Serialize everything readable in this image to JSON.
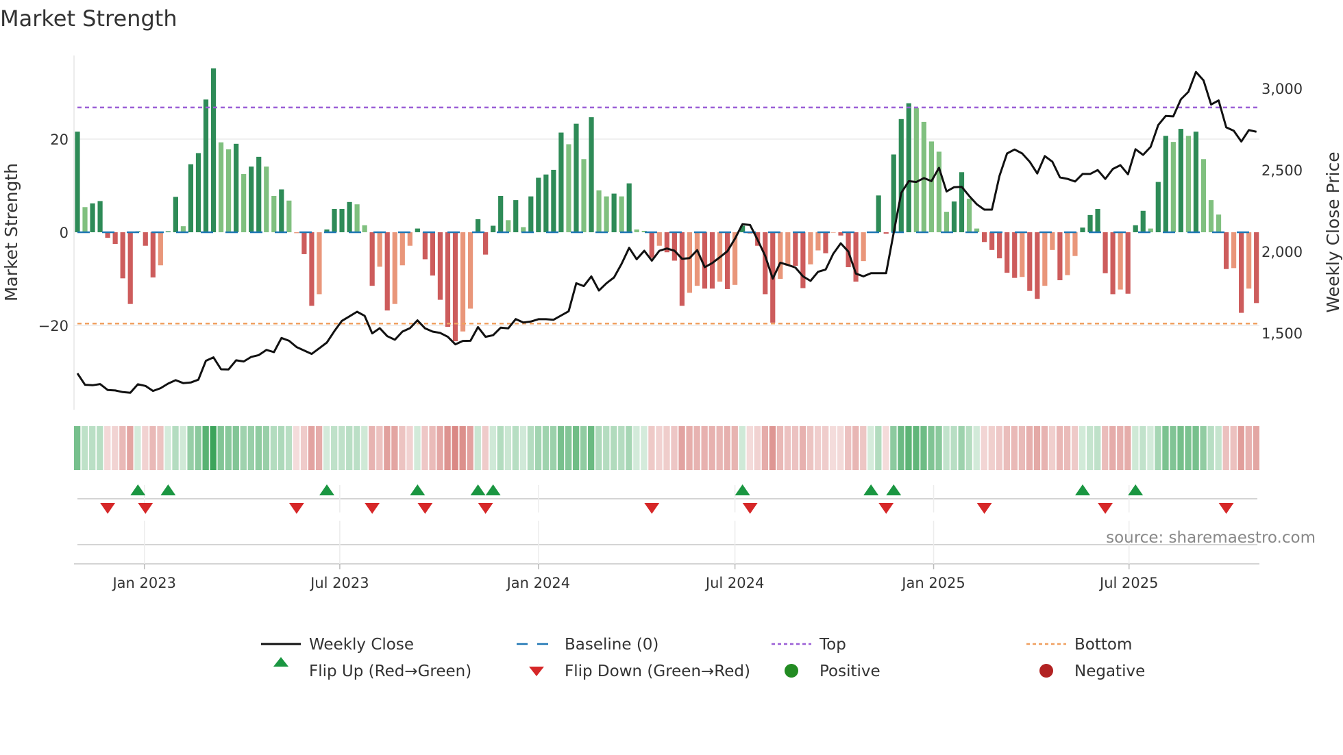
{
  "title": "Market Strength",
  "source": "source: sharemaestro.com",
  "chart_data": {
    "type": "bar",
    "title": "Market Strength",
    "ylabel": "Market Strength",
    "y2label": "Weekly Close Price",
    "ylim": [
      -38.1,
      38.1
    ],
    "y2lim": [
      1029,
      3206
    ],
    "grid": true,
    "legend_placement": "bottom",
    "yticks": [
      {
        "v": 20,
        "label": "20"
      },
      {
        "v": 0,
        "label": "0"
      },
      {
        "v": -20,
        "label": "−20"
      }
    ],
    "y2ticks": [
      {
        "v": 3000,
        "label": "3,000"
      },
      {
        "v": 2500,
        "label": "2,500"
      },
      {
        "v": 2000,
        "label": "2,000"
      },
      {
        "v": 1500,
        "label": "1,500"
      }
    ],
    "xticks": [
      {
        "date": "2023-01-01",
        "label": "Jan 2023"
      },
      {
        "date": "2023-07-01",
        "label": "Jul 2023"
      },
      {
        "date": "2024-01-01",
        "label": "Jan 2024"
      },
      {
        "date": "2024-07-01",
        "label": "Jul 2024"
      },
      {
        "date": "2025-01-01",
        "label": "Jan 2025"
      },
      {
        "date": "2025-07-01",
        "label": "Jul 2025"
      }
    ],
    "start_date": "2022-10-31",
    "frequency": "weekly",
    "top": 26.8,
    "bottom": -19.6,
    "baseline": 0,
    "strength": [
      21.6,
      5.4,
      6.2,
      6.7,
      -1.2,
      -2.5,
      -9.9,
      -15.4,
      0.2,
      -2.9,
      -9.7,
      -7.1,
      0.2,
      7.6,
      1.3,
      14.6,
      17.0,
      28.5,
      35.2,
      19.3,
      17.8,
      19.0,
      12.5,
      14.1,
      16.2,
      14.1,
      7.8,
      9.2,
      6.8,
      -0.2,
      -4.7,
      -15.8,
      -13.3,
      0.6,
      5.0,
      5.0,
      6.5,
      6.0,
      1.5,
      -11.5,
      -7.4,
      -16.8,
      -15.4,
      -7.1,
      -2.9,
      0.8,
      -5.8,
      -9.3,
      -14.5,
      -20.3,
      -23.4,
      -21.3,
      -16.4,
      2.8,
      -4.8,
      1.4,
      7.8,
      2.6,
      6.9,
      1.1,
      7.7,
      11.7,
      12.4,
      13.4,
      21.4,
      18.9,
      23.3,
      15.7,
      24.7,
      9.0,
      7.7,
      8.3,
      7.7,
      10.5,
      0.6,
      0.3,
      -5.5,
      -2.9,
      -4.3,
      -6.1,
      -15.8,
      -13.0,
      -11.5,
      -12.1,
      -12.1,
      -10.6,
      -12.2,
      -11.3,
      1.4,
      -0.3,
      -2.9,
      -13.3,
      -19.4,
      -10.0,
      -7.2,
      -7.2,
      -12.0,
      -6.9,
      -3.9,
      -4.5,
      -0.1,
      -0.7,
      -7.5,
      -10.6,
      -6.2,
      0.1,
      7.9,
      -0.3,
      16.7,
      24.3,
      27.7,
      26.7,
      23.7,
      19.5,
      17.3,
      4.4,
      6.6,
      12.9,
      7.2,
      0.8,
      -2.1,
      -3.8,
      -5.6,
      -8.7,
      -9.8,
      -9.6,
      -12.6,
      -14.3,
      -11.5,
      -3.8,
      -10.3,
      -9.2,
      -5.1,
      1.0,
      3.7,
      5.0,
      -8.8,
      -13.3,
      -12.3,
      -13.2,
      1.5,
      4.6,
      0.8,
      10.8,
      20.7,
      19.4,
      22.2,
      20.7,
      21.6,
      15.7,
      6.9,
      3.8,
      -7.9,
      -7.7,
      -17.3,
      -12.1,
      -15.2
    ],
    "tone": [
      "GgGGRRRRGR",
      "RrGGgGGGGg",
      "gGgGGggGgr",
      "RRrGGGGggR",
      "rRrrrGRRRR",
      "RrrGRGGgGg",
      "GGGGGgGgGg",
      "gGgGggRrRR",
      "RrrRRrRrGr",
      "RRRrrRRrrR",
      "rRRRrGGRGG",
      "GgggggGGgg",
      "RRRRRrRRrr",
      "RrrGGGRRrR",
      "GGgGGgGgGg",
      "ggRrRrR"
    ],
    "close": [
      1252,
      1182,
      1179,
      1186,
      1150,
      1147,
      1137,
      1133,
      1185,
      1175,
      1144,
      1161,
      1189,
      1210,
      1192,
      1196,
      1213,
      1329,
      1350,
      1277,
      1276,
      1332,
      1325,
      1353,
      1364,
      1396,
      1382,
      1469,
      1452,
      1413,
      1392,
      1371,
      1406,
      1441,
      1511,
      1574,
      1602,
      1630,
      1605,
      1497,
      1529,
      1480,
      1458,
      1508,
      1529,
      1577,
      1528,
      1508,
      1500,
      1476,
      1430,
      1451,
      1452,
      1536,
      1476,
      1486,
      1532,
      1528,
      1585,
      1564,
      1570,
      1584,
      1584,
      1581,
      1607,
      1633,
      1805,
      1787,
      1847,
      1760,
      1805,
      1840,
      1924,
      2022,
      1952,
      2004,
      1943,
      2004,
      2018,
      2004,
      1955,
      1959,
      2008,
      1903,
      1929,
      1964,
      2001,
      2078,
      2167,
      2162,
      2071,
      1973,
      1833,
      1931,
      1917,
      1901,
      1847,
      1819,
      1875,
      1889,
      1985,
      2050,
      1999,
      1864,
      1847,
      1866,
      1866,
      1866,
      2113,
      2359,
      2431,
      2426,
      2450,
      2431,
      2513,
      2368,
      2394,
      2396,
      2340,
      2289,
      2256,
      2256,
      2464,
      2601,
      2625,
      2601,
      2550,
      2478,
      2585,
      2550,
      2454,
      2445,
      2429,
      2475,
      2475,
      2499,
      2445,
      2506,
      2529,
      2473,
      2627,
      2592,
      2641,
      2775,
      2831,
      2828,
      2933,
      2979,
      3101,
      3049,
      2901,
      2926,
      2761,
      2740,
      2674,
      2744,
      2734
    ],
    "flip_up_weeks": [
      9,
      13,
      34,
      46,
      54,
      56,
      89,
      106,
      109,
      134,
      141
    ],
    "flip_down_weeks": [
      5,
      10,
      30,
      40,
      47,
      55,
      77,
      90,
      108,
      121,
      137,
      153
    ],
    "legend": [
      {
        "label": "Weekly Close",
        "kind": "line"
      },
      {
        "label": "Baseline (0)",
        "kind": "dash"
      },
      {
        "label": "Top",
        "kind": "dot-top"
      },
      {
        "label": "Bottom",
        "kind": "dot-bottom"
      },
      {
        "label": "Flip Up (Red→Green)",
        "kind": "up"
      },
      {
        "label": "Flip Down (Green→Red)",
        "kind": "down"
      },
      {
        "label": "Positive",
        "kind": "pos"
      },
      {
        "label": "Negative",
        "kind": "neg"
      }
    ],
    "colors": {
      "G": "#2e8b57",
      "g": "#80c07f",
      "R": "#cd5c5c",
      "r": "#e9967a",
      "close": "#111111",
      "baseline": "#1f77b4",
      "top": "#9b5fd6",
      "bottom": "#f0a060",
      "up": "#1a9641",
      "down": "#d62728",
      "pos": "#228b22",
      "neg": "#b22222",
      "heat_pos": "#2e9e4f",
      "heat_neg": "#c9524d"
    }
  }
}
